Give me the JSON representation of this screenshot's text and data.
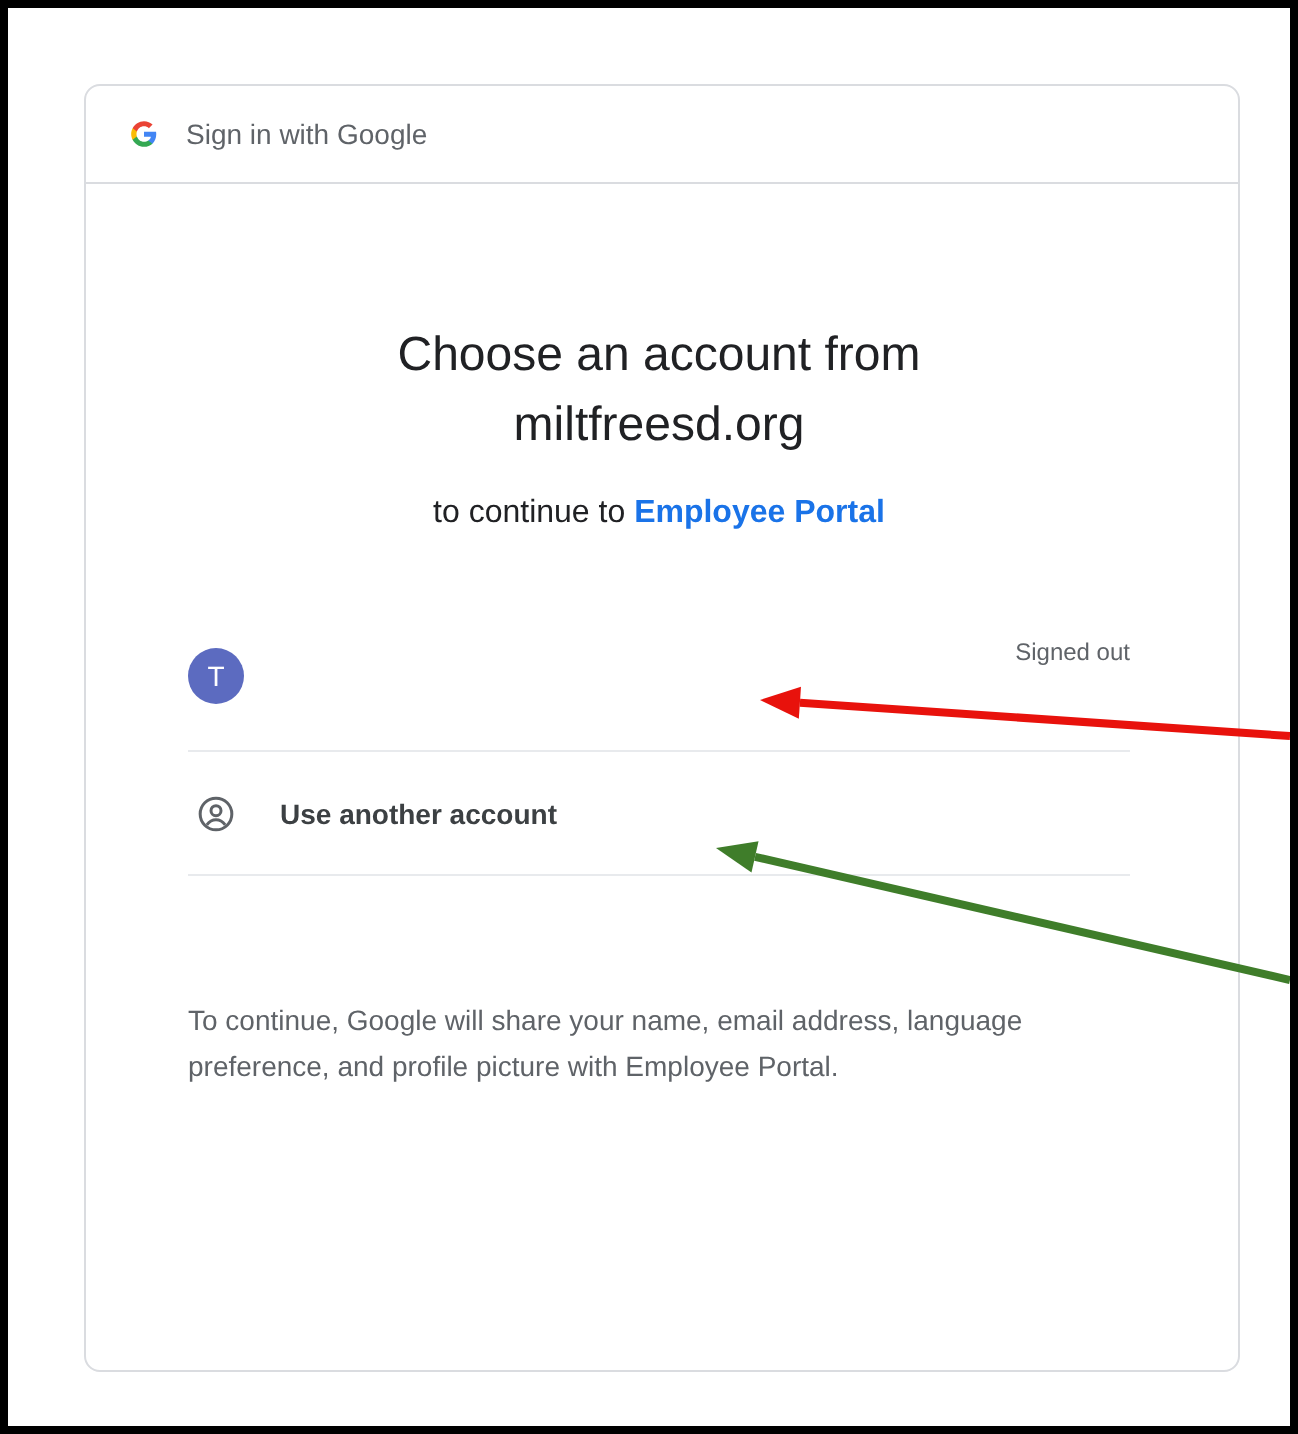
{
  "header": {
    "title": "Sign in with Google"
  },
  "heading": "Choose an account from miltfreesd.org",
  "subtitle": {
    "text": "to continue to",
    "link": "Employee Portal"
  },
  "accounts": [
    {
      "kind": "account",
      "initial": "T",
      "status": "Signed out"
    },
    {
      "kind": "other",
      "label": "Use another account"
    }
  ],
  "notice": "To continue, Google will share your name, email address, language preference, and profile picture with Employee Portal.",
  "annotations": [
    {
      "kind": "arrow",
      "color": "#e8120c"
    },
    {
      "kind": "arrow",
      "color": "#3f7d2a"
    }
  ]
}
